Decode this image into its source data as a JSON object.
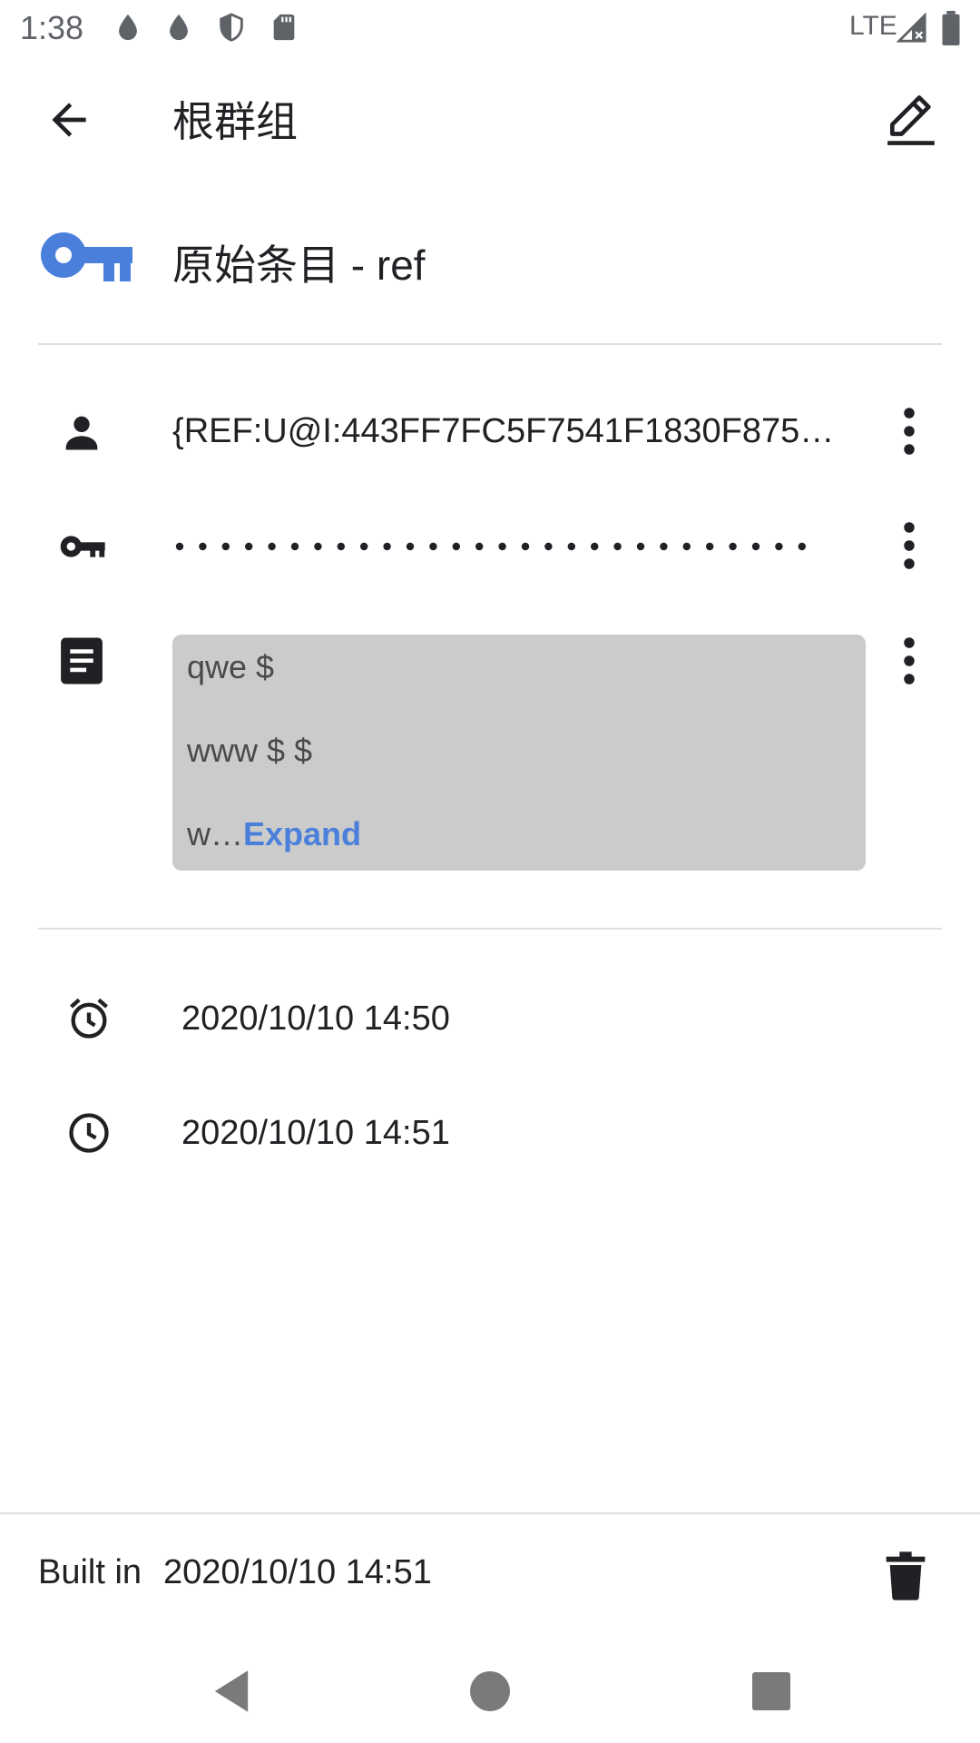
{
  "status_bar": {
    "time": "1:38",
    "network": "LTE",
    "icons": [
      "drop-icon",
      "drop-icon",
      "shield-icon",
      "sd-card-icon",
      "signal-icon",
      "battery-icon"
    ]
  },
  "app_bar": {
    "title": "根群组",
    "back_icon": "arrow-back-icon",
    "edit_icon": "edit-icon"
  },
  "entry": {
    "title": "原始条目 - ref",
    "icon": "key-icon",
    "accent_color": "#4a7fdc"
  },
  "fields": {
    "username": {
      "icon": "person-icon",
      "value": "{REF:U@I:443FF7FC5F7541F1830F875…"
    },
    "password": {
      "icon": "key-icon",
      "masked": "••••••••••••••••••••••••••••"
    },
    "notes": {
      "icon": "document-icon",
      "lines": [
        "qwe $",
        "www $ $",
        "w…"
      ],
      "expand_label": "Expand"
    }
  },
  "dates": {
    "created": "2020/10/10 14:50",
    "modified": "2020/10/10 14:51"
  },
  "footer": {
    "built_label": "Built in",
    "built_value": "2020/10/10 14:51",
    "delete_icon": "delete-icon"
  },
  "nav_bar": {
    "icons": [
      "nav-back-icon",
      "nav-home-icon",
      "nav-recents-icon"
    ]
  }
}
